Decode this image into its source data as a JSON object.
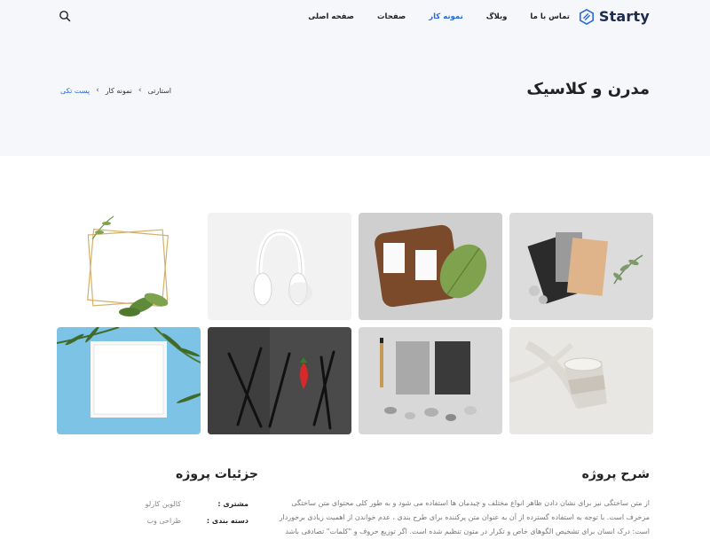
{
  "brand": {
    "name": "Starty",
    "accent": "#2a6bd8",
    "text_color": "#1d2b4f"
  },
  "nav": {
    "items": [
      {
        "label": "صفحه اصلی",
        "active": false
      },
      {
        "label": "صفحات",
        "active": false
      },
      {
        "label": "نمونه کار",
        "active": true
      },
      {
        "label": "وبلاگ",
        "active": false
      },
      {
        "label": "تماس با ما",
        "active": false
      }
    ],
    "search_icon": "search-icon"
  },
  "hero": {
    "title": "مدرن و کلاسیک",
    "background": "#f6f7fb"
  },
  "breadcrumb": {
    "home": "استارتی",
    "section": "نمونه کار",
    "current": "پست تکی"
  },
  "gallery": {
    "images": [
      {
        "name": "black-envelopes-stationery"
      },
      {
        "name": "business-cards-wooden-tray"
      },
      {
        "name": "white-headphones"
      },
      {
        "name": "gold-frame-with-leaves"
      },
      {
        "name": "paper-coffee-cup"
      },
      {
        "name": "stationery-pen-pebbles"
      },
      {
        "name": "black-forks-strawberry"
      },
      {
        "name": "white-frame-palm-leaves"
      }
    ]
  },
  "description": {
    "title": "شرح پروژه",
    "text": "از متن ساختگی نیز برای نشان دادن ظاهر انواع مختلف و چیدمان ها استفاده می شود و به طور کلی محتوای متن ساختگی مزخرف است. با توجه به استفاده گسترده از آن به عنوان متن پرکننده برای طرح بندی ، عدم خواندن از اهمیت زیادی برخوردار است: درک انسان برای تشخیص الگوهای خاص و تکرار در متون تنظیم شده است. اگر توزیع حروف و \"کلمات\" تصادفی باشد"
  },
  "details": {
    "title": "جزئیات پروژه",
    "rows": [
      {
        "label": "مشتری :",
        "value": "کالوین کارلو"
      },
      {
        "label": "دسته بندی :",
        "value": "طراحی وب"
      }
    ]
  }
}
